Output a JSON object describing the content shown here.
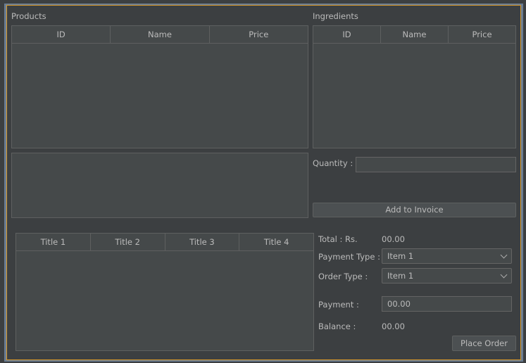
{
  "products": {
    "title": "Products",
    "columns": [
      "ID",
      "Name",
      "Price"
    ]
  },
  "ingredients": {
    "title": "Ingredients",
    "columns": [
      "ID",
      "Name",
      "Price"
    ]
  },
  "quantity": {
    "label": "Quantity :",
    "value": ""
  },
  "add_to_invoice": "Add to Invoice",
  "invoice": {
    "columns": [
      "Title 1",
      "Title 2",
      "Title 3",
      "Title 4"
    ]
  },
  "total": {
    "label": "Total : Rs.",
    "value": "00.00"
  },
  "payment_type": {
    "label": "Payment Type :",
    "value": "Item 1"
  },
  "order_type": {
    "label": "Order Type :",
    "value": "Item 1"
  },
  "payment": {
    "label": "Payment :",
    "value": "00.00"
  },
  "balance": {
    "label": "Balance :",
    "value": "00.00"
  },
  "place_order": "Place Order",
  "colors": {
    "background": "#3c3f41",
    "table": "#45494a",
    "focus_border": "#d99a2b"
  }
}
